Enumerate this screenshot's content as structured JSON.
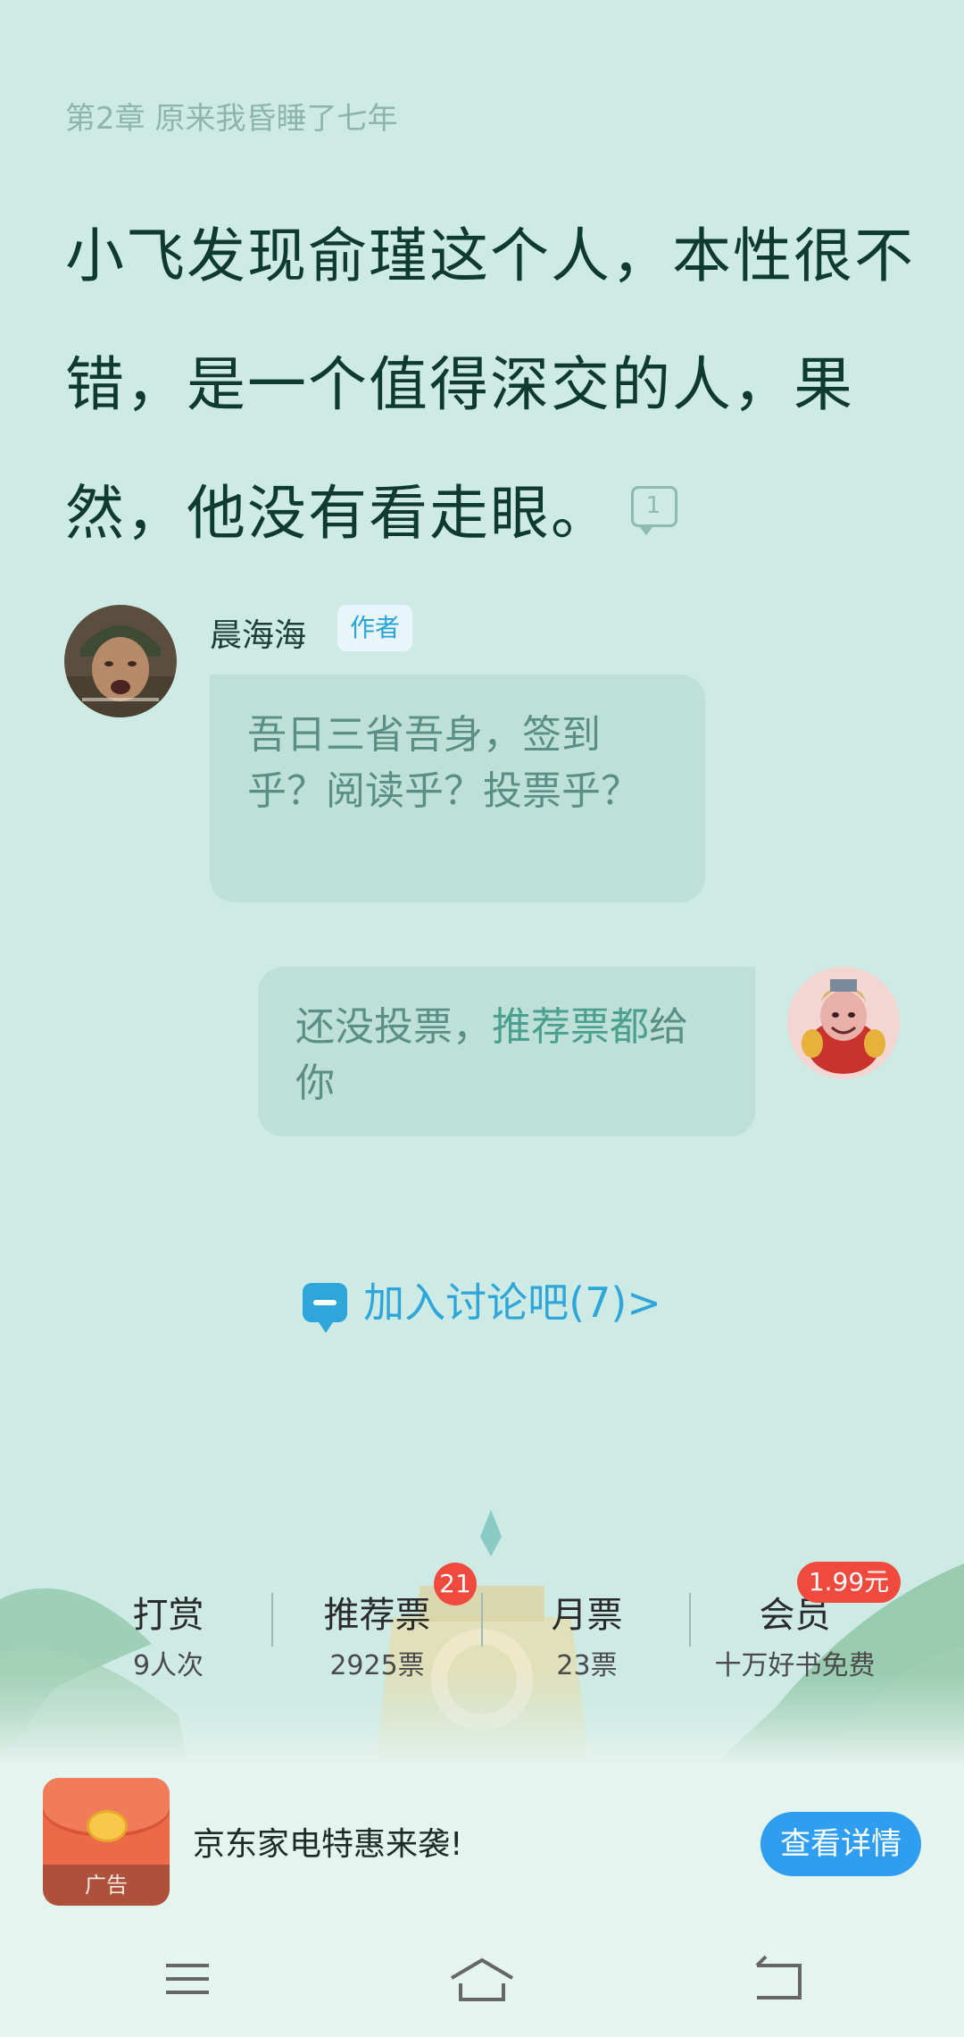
{
  "chapter": {
    "label": "第2章 原来我昏睡了七年"
  },
  "content": {
    "text": "小飞发现俞瑾这个人，本性很不错，是一个值得深交的人，果然，他没有看走眼。",
    "comment_count": "1"
  },
  "author_comment": {
    "name": "晨海海",
    "tag": "作者",
    "text": "吾日三省吾身，签到乎？阅读乎？投票乎？"
  },
  "user_reply": {
    "text_before": "还没投票，",
    "text_highlight": "推荐票都",
    "text_after": "给你"
  },
  "discussion": {
    "label": "加入讨论吧(7)>"
  },
  "actions": [
    {
      "title": "打赏",
      "sub": "9人次"
    },
    {
      "title": "推荐票",
      "sub": "2925票",
      "badge": "21"
    },
    {
      "title": "月票",
      "sub": "23票"
    },
    {
      "title": "会员",
      "sub": "十万好书免费",
      "badge": "1.99元"
    }
  ],
  "ad": {
    "label": "广告",
    "text": "京东家电特惠来袭!",
    "button": "查看详情"
  },
  "colors": {
    "background": "#cdeae4",
    "accent_blue": "#2fa6da",
    "badge_red": "#f04a3f"
  },
  "icons": {
    "menu": "menu-icon",
    "home": "home-icon",
    "back": "back-icon",
    "comment": "comment-bubble-icon"
  }
}
